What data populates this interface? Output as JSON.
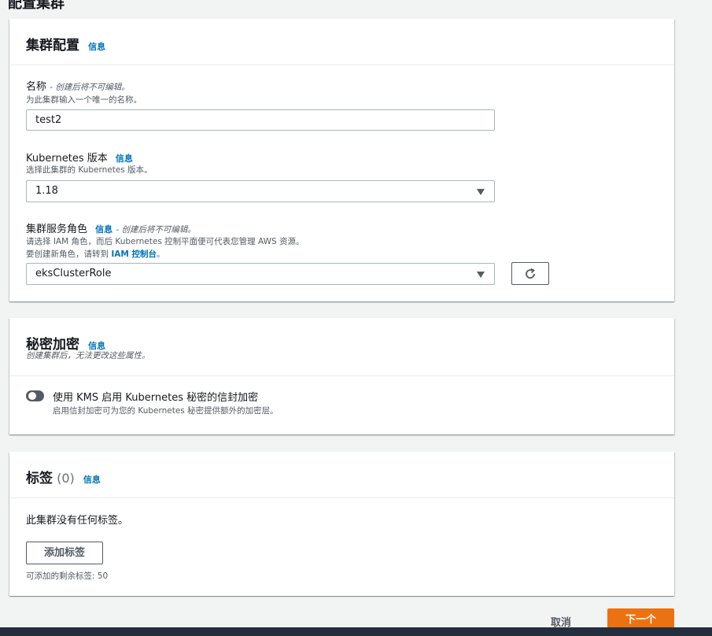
{
  "page": {
    "top_heading_partial": "配置集群"
  },
  "cluster_config": {
    "title": "集群配置",
    "info": "信息",
    "name": {
      "label": "名称",
      "label_note": "- 创建后将不可编辑。",
      "description": "为此集群输入一个唯一的名称。",
      "value": "test2"
    },
    "version": {
      "label": "Kubernetes 版本",
      "info": "信息",
      "description": "选择此集群的 Kubernetes 版本。",
      "value": "1.18"
    },
    "role": {
      "label": "集群服务角色",
      "info": "信息",
      "label_note": "- 创建后将不可编辑。",
      "description": "请选择 IAM 角色，而后 Kubernetes 控制平面便可代表您管理 AWS 资源。",
      "description2_prefix": "要创建新角色，请转到 ",
      "description2_link": "IAM 控制台",
      "description2_suffix": "。",
      "value": "eksClusterRole"
    }
  },
  "secrets": {
    "title": "秘密加密",
    "info": "信息",
    "subtitle": "创建集群后，无法更改这些属性。",
    "toggle_label": "使用 KMS 启用 Kubernetes 秘密的信封加密",
    "toggle_description": "启用信封加密可为您的 Kubernetes 秘密提供额外的加密层。",
    "toggle_on": false
  },
  "tags": {
    "title": "标签",
    "count": "(0)",
    "info": "信息",
    "empty_text": "此集群没有任何标签。",
    "add_button": "添加标签",
    "remaining": "可添加的剩余标签: 50"
  },
  "footer": {
    "cancel": "取消",
    "next": "下一个"
  },
  "colors": {
    "accent": "#ec7211",
    "link": "#0073bb",
    "text": "#16191f",
    "muted": "#545b64"
  }
}
